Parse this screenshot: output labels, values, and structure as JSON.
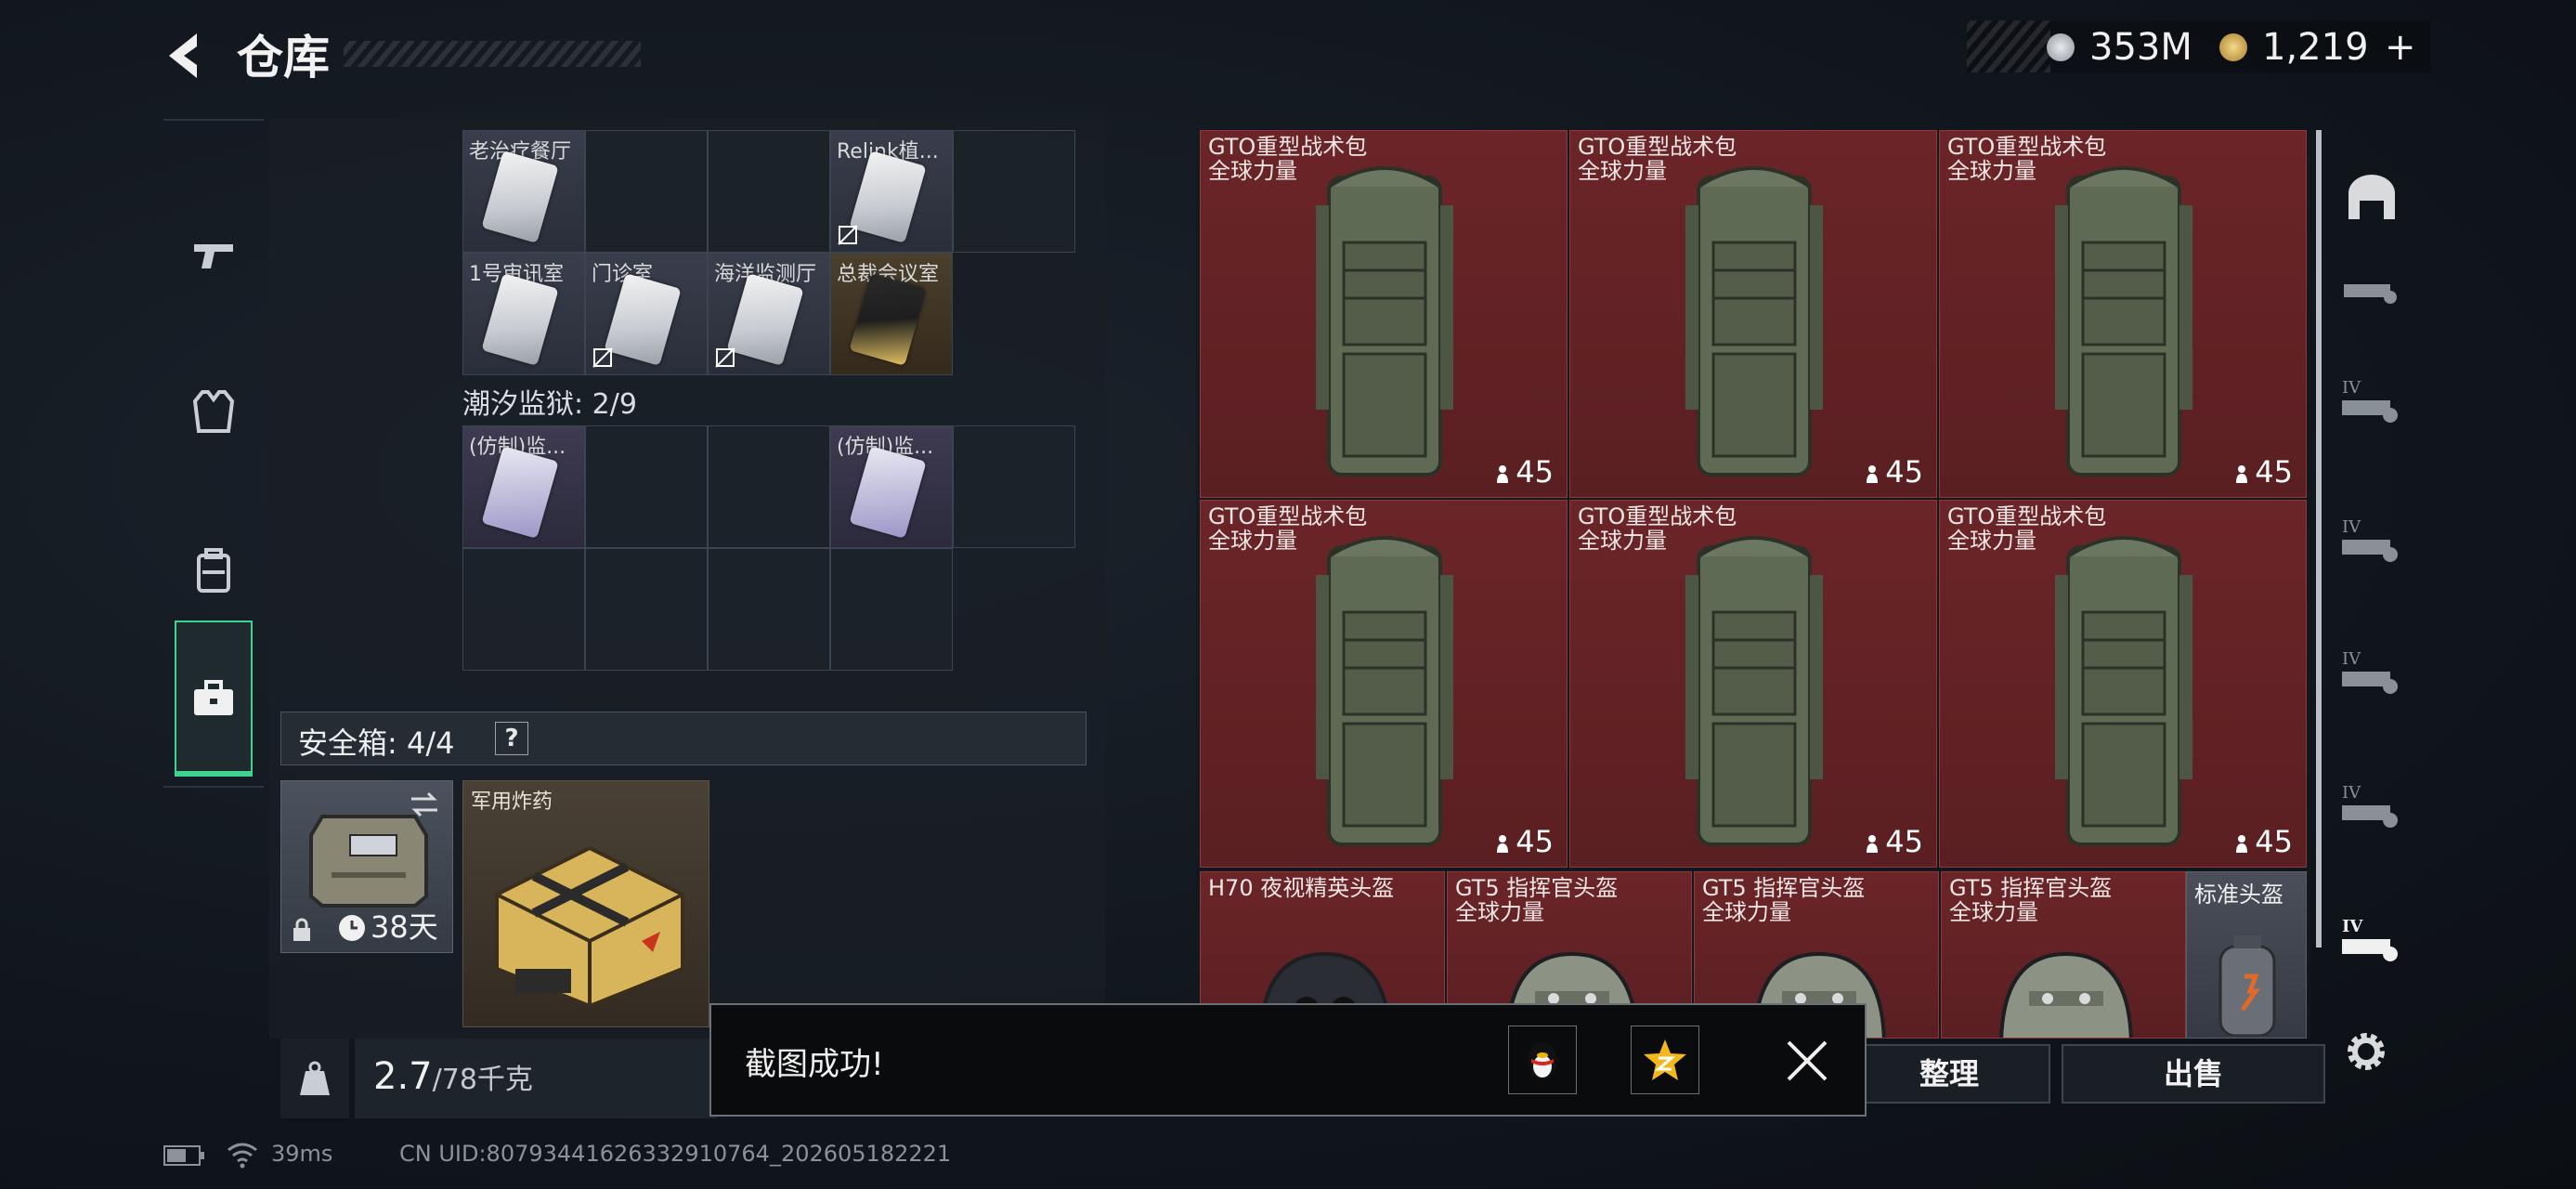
{
  "header": {
    "title": "仓库"
  },
  "currency": {
    "silver": "353M",
    "gold": "1,219",
    "gold_add": "+"
  },
  "left_nav": [
    {
      "name": "weapons",
      "icon": "pistol-icon"
    },
    {
      "name": "equipment",
      "icon": "vest-icon"
    },
    {
      "name": "backpack",
      "icon": "backpack-icon"
    },
    {
      "name": "items",
      "icon": "toolbox-icon",
      "active": true
    }
  ],
  "keycards": {
    "row1": [
      {
        "label": "老治疗餐厅",
        "type": "keycard-silver",
        "locked": false
      },
      {
        "label": "",
        "type": "empty"
      },
      {
        "label": "",
        "type": "empty"
      },
      {
        "label": "Relink植...",
        "type": "keycard-silver",
        "locked": true
      },
      {
        "label": "",
        "type": "empty"
      }
    ],
    "row2": [
      {
        "label": "1号审讯室",
        "type": "keycard-silver",
        "locked": false
      },
      {
        "label": "门诊室",
        "type": "keycard-silver",
        "locked": true
      },
      {
        "label": "海洋监测厅",
        "type": "keycard-silver",
        "locked": true
      },
      {
        "label": "总裁会议室",
        "type": "keycard-gold",
        "locked": false
      }
    ]
  },
  "prison": {
    "title": "潮汐监狱: 2/9",
    "row1": [
      {
        "label": "(仿制)监...",
        "type": "keycard-purple"
      },
      {
        "label": "",
        "type": "empty"
      },
      {
        "label": "",
        "type": "empty"
      },
      {
        "label": "(仿制)监...",
        "type": "keycard-purple"
      },
      {
        "label": "",
        "type": "empty"
      }
    ]
  },
  "safebox": {
    "label": "安全箱: 4/4",
    "help": "?",
    "days": "38天",
    "explosive_label": "军用炸药"
  },
  "weight": {
    "current": "2.7",
    "max": "/78千克"
  },
  "inventory": {
    "packs": [
      {
        "name": "GTO重型战术包",
        "sub": "全球力量",
        "count": "45"
      },
      {
        "name": "GTO重型战术包",
        "sub": "全球力量",
        "count": "45"
      },
      {
        "name": "GTO重型战术包",
        "sub": "全球力量",
        "count": "45"
      },
      {
        "name": "GTO重型战术包",
        "sub": "全球力量",
        "count": "45"
      },
      {
        "name": "GTO重型战术包",
        "sub": "全球力量",
        "count": "45"
      },
      {
        "name": "GTO重型战术包",
        "sub": "全球力量",
        "count": "45"
      }
    ],
    "helmets": [
      {
        "name": "H70 夜视精英头盔",
        "sub": ""
      },
      {
        "name": "GT5 指挥官头盔",
        "sub": "全球力量"
      },
      {
        "name": "GT5 指挥官头盔",
        "sub": "全球力量"
      },
      {
        "name": "GT5 指挥官头盔",
        "sub": "全球力量"
      }
    ],
    "plain_helmet": "标准头盔"
  },
  "buttons": {
    "sort": "整理",
    "sell": "出售"
  },
  "toast": {
    "text": "截图成功!"
  },
  "status": {
    "ping": "39ms",
    "uid": "CN UID:8079344162633291076​4_202605182221"
  },
  "colors": {
    "accent": "#3fd38f",
    "tile_red": "#6b2528",
    "currency_gold": "#c9a44a"
  }
}
